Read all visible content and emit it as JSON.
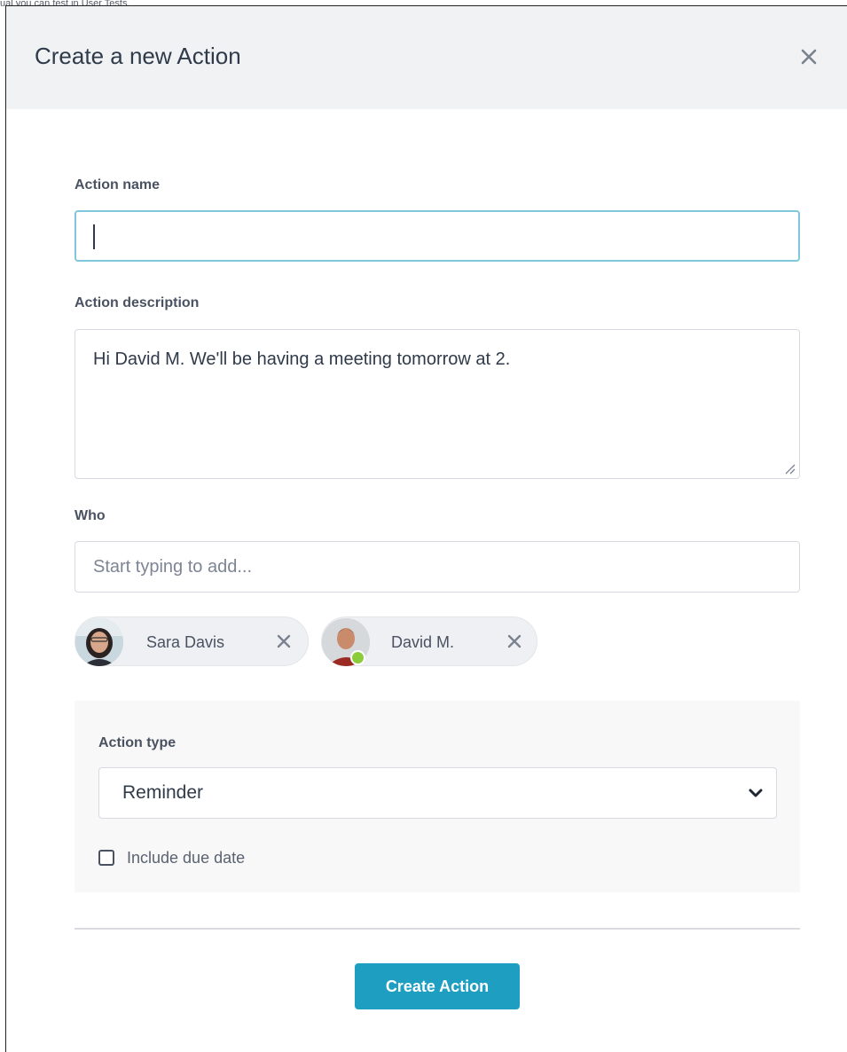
{
  "caption": "ual you can test in User Tests.",
  "modal": {
    "title": "Create a new Action"
  },
  "form": {
    "name_label": "Action name",
    "name_value": "",
    "description_label": "Action description",
    "description_value": "Hi David M. We'll be having a meeting tomorrow at 2.",
    "who_label": "Who",
    "who_placeholder": "Start typing to add...",
    "people": [
      {
        "name": "Sara Davis",
        "online": false
      },
      {
        "name": "David M.",
        "online": true
      }
    ],
    "type_label": "Action type",
    "type_selected": "Reminder",
    "due_date_label": "Include due date",
    "due_date_checked": false,
    "submit_label": "Create Action"
  },
  "colors": {
    "primary": "#1e9ec0",
    "focus_border": "#7fc8dc",
    "online_status": "#8bcc3a",
    "header_bg": "#f1f2f4"
  }
}
